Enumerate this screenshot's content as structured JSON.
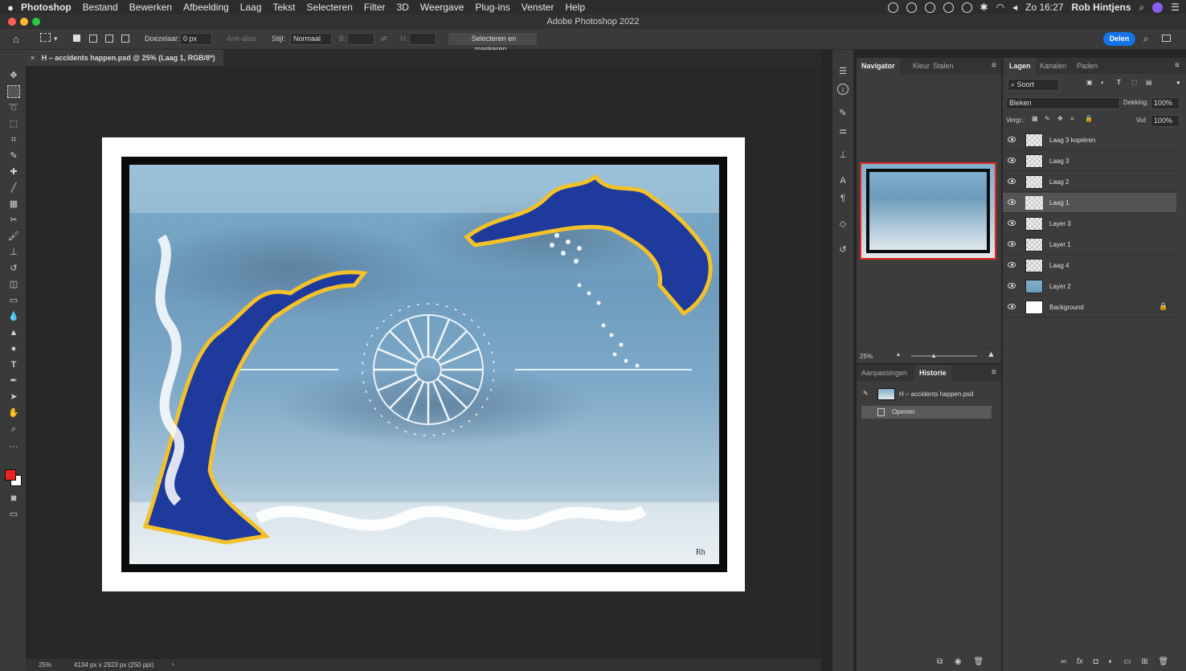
{
  "menubar": {
    "apple": "",
    "app": "Photoshop",
    "items": [
      "Bestand",
      "Bewerken",
      "Afbeelding",
      "Laag",
      "Tekst",
      "Selecteren",
      "Filter",
      "3D",
      "Weergave",
      "Plug-ins",
      "Venster",
      "Help"
    ],
    "clock": "Zo 16:27",
    "user": "Rob Hintjens"
  },
  "window": {
    "title": "Adobe Photoshop 2022"
  },
  "options": {
    "feather_label": "Doezelaar:",
    "feather_value": "0 px",
    "antialias": "Anti-alias",
    "style_label": "Stijl:",
    "style_value": "Normaal",
    "width_label": "B:",
    "height_label": "H:",
    "select_mask": "Selecteren en maskeren...",
    "share": "Delen"
  },
  "document": {
    "tab_title": "H – accidents happen.psd @ 25% (Laag 1, RGB/8*)",
    "zoom": "25%",
    "dimensions": "4134 px x 2923 px (250 ppi)",
    "signature": "Rh"
  },
  "navigator": {
    "tabs": [
      "Navigator",
      "Kleur",
      "Stalen"
    ],
    "zoom": "25%"
  },
  "history": {
    "tabs": [
      "Aanpassingen",
      "Historie"
    ],
    "snapshot": "H – accidents happen.psd",
    "steps": [
      "Openen"
    ]
  },
  "layers_panel": {
    "tabs": [
      "Lagen",
      "Kanalen",
      "Paden"
    ],
    "filter": "Soort",
    "blend_mode": "Bleken",
    "opacity_label": "Dekking:",
    "opacity": "100%",
    "lock_label": "Vergr.:",
    "fill_label": "Vul:",
    "fill": "100%",
    "layers": [
      {
        "name": "Laag 3 kopiëren",
        "selected": false
      },
      {
        "name": "Laag 3",
        "selected": false
      },
      {
        "name": "Laag 2",
        "selected": false
      },
      {
        "name": "Laag 1",
        "selected": true
      },
      {
        "name": "Layer 3",
        "selected": false
      },
      {
        "name": "Layer 1",
        "selected": false
      },
      {
        "name": "Laag 4",
        "selected": false
      },
      {
        "name": "Layer 2",
        "selected": false
      },
      {
        "name": "Background",
        "selected": false
      }
    ]
  },
  "colors": {
    "foreground": "#e8241c",
    "background": "#ffffff",
    "accent": "#1473e6",
    "navigator_box": "#e8241c"
  }
}
